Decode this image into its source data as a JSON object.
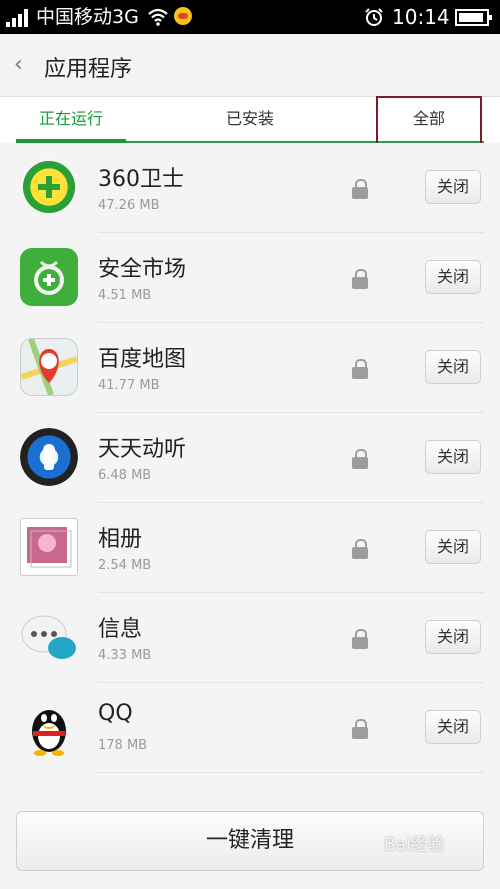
{
  "status_bar": {
    "carrier": "中国移动3G",
    "time": "10:14"
  },
  "header": {
    "title": "应用程序"
  },
  "tabs": [
    {
      "label": "正在运行",
      "active": true
    },
    {
      "label": "已安装",
      "active": false
    },
    {
      "label": "全部",
      "active": false
    }
  ],
  "apps": [
    {
      "name": "360卫士",
      "size": "47.26 MB",
      "icon": "360-security-icon",
      "action": "关闭"
    },
    {
      "name": "安全市场",
      "size": "4.51 MB",
      "icon": "security-market-icon",
      "action": "关闭"
    },
    {
      "name": "百度地图",
      "size": "41.77 MB",
      "icon": "baidu-map-icon",
      "action": "关闭"
    },
    {
      "name": "天天动听",
      "size": "6.48 MB",
      "icon": "ttpod-icon",
      "action": "关闭"
    },
    {
      "name": "相册",
      "size": "2.54 MB",
      "icon": "album-icon",
      "action": "关闭"
    },
    {
      "name": "信息",
      "size": "4.33 MB",
      "icon": "messages-icon",
      "action": "关闭"
    },
    {
      "name": "QQ",
      "size": "178 MB",
      "icon": "qq-icon",
      "action": "关闭"
    }
  ],
  "bottom": {
    "clean_button": "一键清理",
    "watermark": "Bai经验"
  },
  "colors": {
    "accent_green": "#1a9a3a",
    "highlight_box": "#7b1c2a"
  }
}
